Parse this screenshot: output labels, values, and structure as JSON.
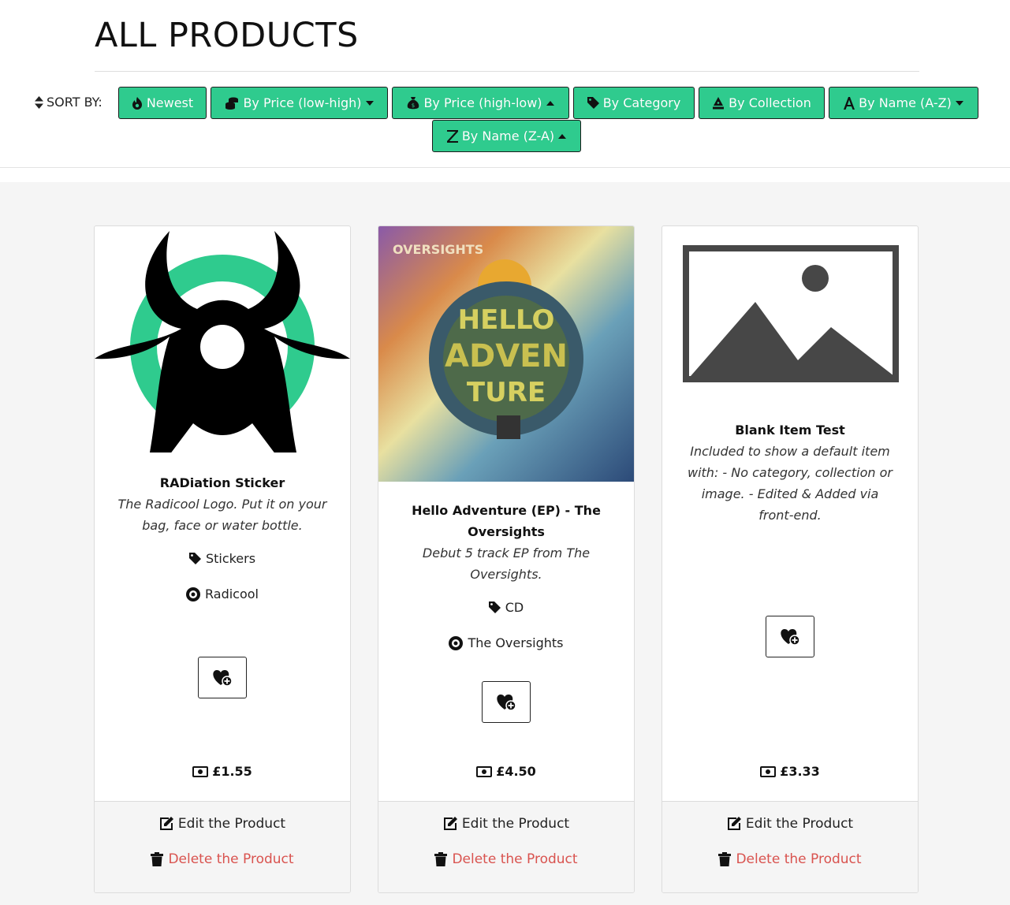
{
  "page": {
    "title": "ALL PRODUCTS"
  },
  "sort": {
    "label": "SORT BY:",
    "buttons": [
      {
        "label": "Newest",
        "icon": "fire-icon"
      },
      {
        "label": "By Price (low-high)",
        "icon": "coins-icon",
        "caret": "down"
      },
      {
        "label": "By Price (high-low)",
        "icon": "money-bag-icon",
        "caret": "up"
      },
      {
        "label": "By Category",
        "icon": "tag-icon"
      },
      {
        "label": "By Collection",
        "icon": "pen-nib-icon"
      },
      {
        "label": "By Name (A-Z)",
        "icon": "letter-a-icon",
        "caret": "down"
      },
      {
        "label": "By Name (Z-A)",
        "icon": "letter-z-icon",
        "caret": "up"
      }
    ]
  },
  "products": [
    {
      "name": "RADiation Sticker",
      "description": "The Radicool Logo. Put it on your bag, face or water bottle.",
      "category": "Stickers",
      "collection": "Radicool",
      "price": "£1.55",
      "image": "radiation-logo-image"
    },
    {
      "name": "Hello Adventure (EP) - The Oversights",
      "description": "Debut 5 track EP from The Oversights.",
      "category": "CD",
      "collection": "The Oversights",
      "price": "£4.50",
      "image": "album-cover-image",
      "image_text": {
        "band": "OVERSIGHTS",
        "album_top": "HELLO",
        "album_mid": "ADVEN",
        "album_bottom": "TURE"
      }
    },
    {
      "name": "Blank Item Test",
      "description": "Included to show a default item with: - No category, collection or image. - Edited & Added via front-end.",
      "price": "£3.33",
      "image": "placeholder-image"
    }
  ],
  "actions": {
    "edit": "Edit the Product",
    "delete": "Delete the Product"
  },
  "colors": {
    "accent": "#2fcb8e",
    "danger": "#d9534f",
    "panel": "#f5f5f5"
  }
}
